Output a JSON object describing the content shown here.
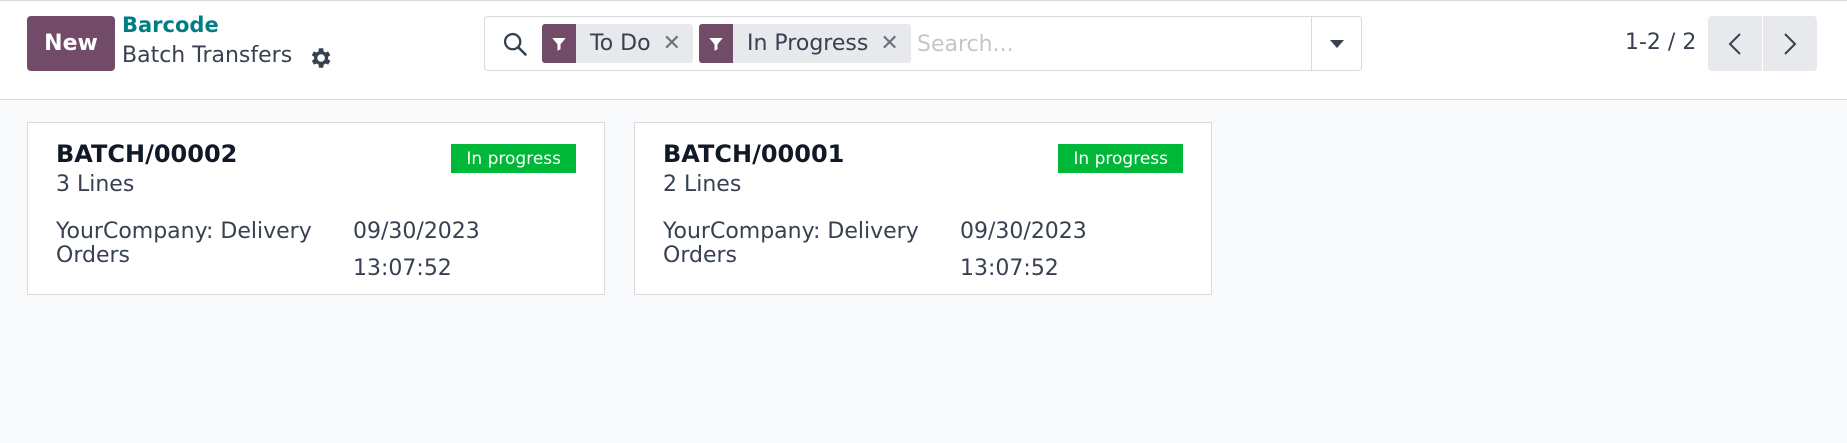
{
  "control_panel": {
    "new_label": "New",
    "breadcrumb_parent": "Barcode",
    "breadcrumb_current": "Batch Transfers"
  },
  "search": {
    "facets": [
      {
        "label": "To Do",
        "icon": "filter-icon"
      },
      {
        "label": "In Progress",
        "icon": "filter-icon"
      }
    ],
    "placeholder": "Search..."
  },
  "pager": {
    "value": "1-2 / 2"
  },
  "cards": [
    {
      "name": "BATCH/00002",
      "lines": "3 Lines",
      "operation_type": "YourCompany: Delivery Orders",
      "date": "09/30/2023",
      "time": "13:07:52",
      "state": "In progress"
    },
    {
      "name": "BATCH/00001",
      "lines": "2 Lines",
      "operation_type": "YourCompany: Delivery Orders",
      "date": "09/30/2023",
      "time": "13:07:52",
      "state": "In progress"
    }
  ],
  "colors": {
    "primary": "#714b67",
    "link": "#017e84",
    "badge_in_progress": "#00b838"
  }
}
